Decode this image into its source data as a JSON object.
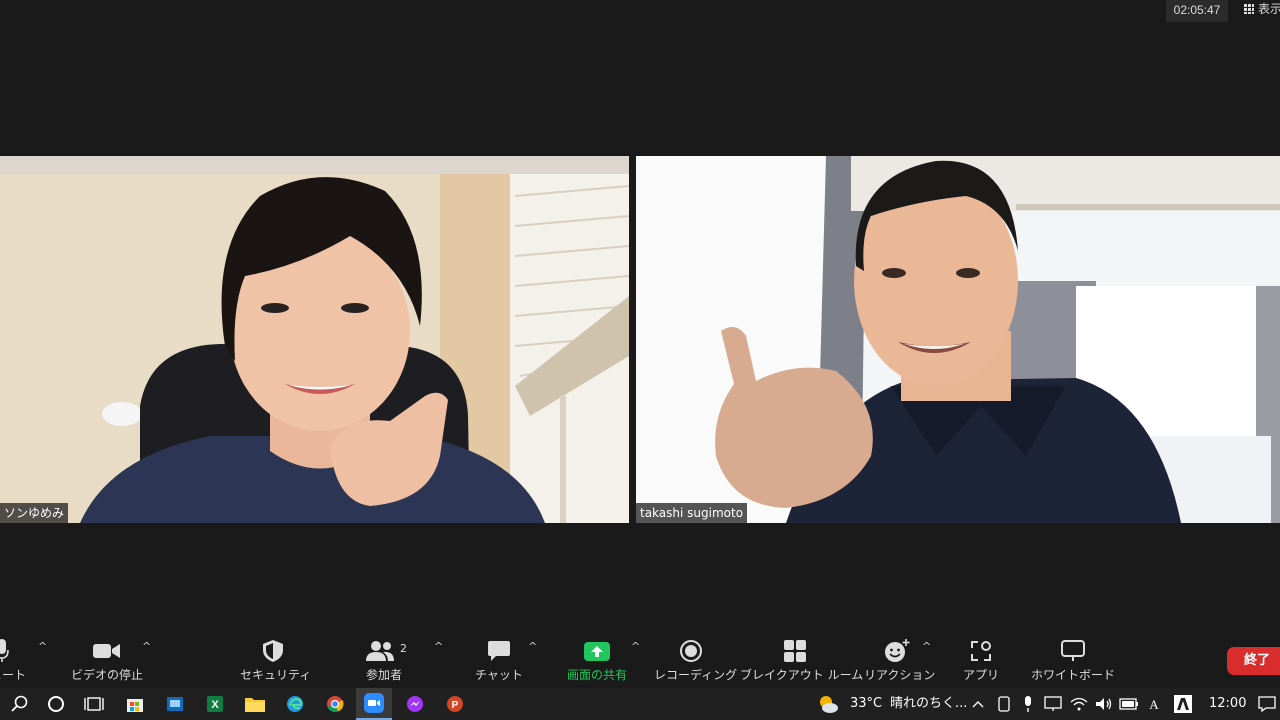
{
  "meeting": {
    "timer": "02:05:47",
    "view_label": "表示"
  },
  "participants": [
    {
      "name": "ソンゆめみ"
    },
    {
      "name": "takashi sugimoto"
    }
  ],
  "toolbar": {
    "mute": "ミュート",
    "video": "ビデオの停止",
    "security": "セキュリティ",
    "participants": "参加者",
    "participants_count": "2",
    "chat": "チャット",
    "share": "画面の共有",
    "recording": "レコーディング",
    "breakout": "ブレイクアウト ルーム",
    "reactions": "リアクション",
    "apps": "アプリ",
    "whiteboard": "ホワイトボード",
    "end": "終了"
  },
  "taskbar": {
    "weather_temp": "33°C",
    "weather_text": "晴れのちく...",
    "clock": "12:00"
  },
  "colors": {
    "background": "#1a1a1a",
    "share_green": "#22c55e",
    "end_red": "#d92c2c",
    "taskbar": "#202020"
  }
}
